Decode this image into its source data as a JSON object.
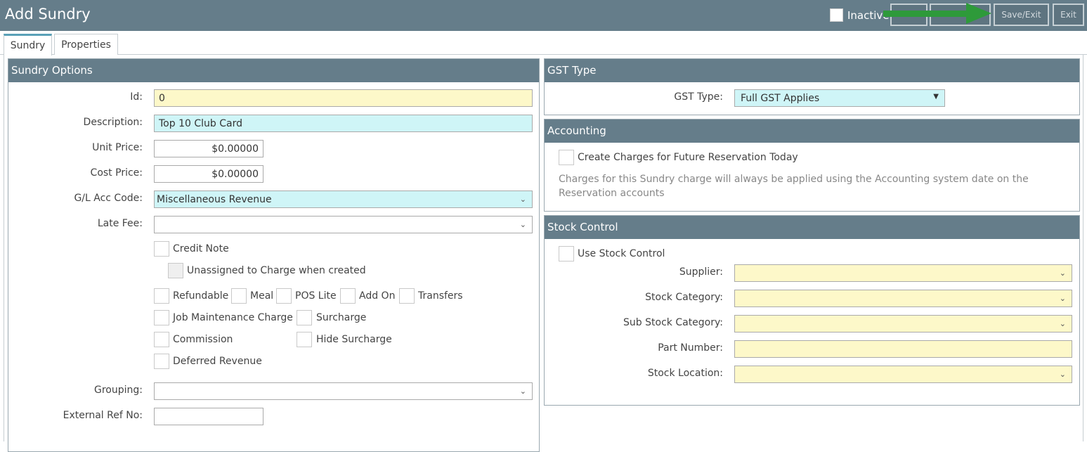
{
  "header": {
    "title": "Add Sundry",
    "inactive_label": "Inactive",
    "save_exit_label": "Save/Exit",
    "exit_label": "Exit",
    "arrow_color": "#2e9a3a"
  },
  "tabs": [
    {
      "label": "Sundry"
    },
    {
      "label": "Properties"
    }
  ],
  "sundry_options": {
    "heading": "Sundry Options",
    "id_label": "Id:",
    "id_value": "0",
    "description_label": "Description:",
    "description_value": "Top 10 Club Card",
    "unit_price_label": "Unit Price:",
    "unit_price_value": "$0.00000",
    "cost_price_label": "Cost Price:",
    "cost_price_value": "$0.00000",
    "gl_label": "G/L Acc Code:",
    "gl_value": "Miscellaneous Revenue",
    "late_fee_label": "Late Fee:",
    "late_fee_value": "",
    "checkboxes": {
      "credit_note": "Credit Note",
      "unassigned": "Unassigned to Charge when created",
      "refundable": "Refundable",
      "meal": "Meal",
      "pos_lite": "POS Lite",
      "add_on": "Add On",
      "transfers": "Transfers",
      "job_maintenance": "Job Maintenance Charge",
      "surcharge": "Surcharge",
      "commission": "Commission",
      "hide_surcharge": "Hide Surcharge",
      "deferred_revenue": "Deferred Revenue"
    },
    "grouping_label": "Grouping:",
    "grouping_value": "",
    "external_ref_label": "External Ref No:",
    "external_ref_value": ""
  },
  "gst": {
    "heading": "GST Type",
    "type_label": "GST Type:",
    "type_value": "Full GST Applies"
  },
  "accounting": {
    "heading": "Accounting",
    "create_charges_label": "Create Charges for Future Reservation Today",
    "note_line1": "Charges for this Sundry charge will always be applied using the Accounting system date on the",
    "note_line2": "Reservation accounts"
  },
  "stock": {
    "heading": "Stock Control",
    "use_stock_label": "Use Stock Control",
    "supplier_label": "Supplier:",
    "category_label": "Stock Category:",
    "sub_category_label": "Sub Stock Category:",
    "part_number_label": "Part Number:",
    "location_label": "Stock Location:"
  },
  "icons": {
    "chevron": "chevron-down-icon",
    "caret": "caret-down-icon",
    "arrow": "arrow-right-icon"
  },
  "colors": {
    "header": "#657d8a",
    "yellow_field": "#fdf8c9",
    "cyan_field": "#cff5f7"
  }
}
